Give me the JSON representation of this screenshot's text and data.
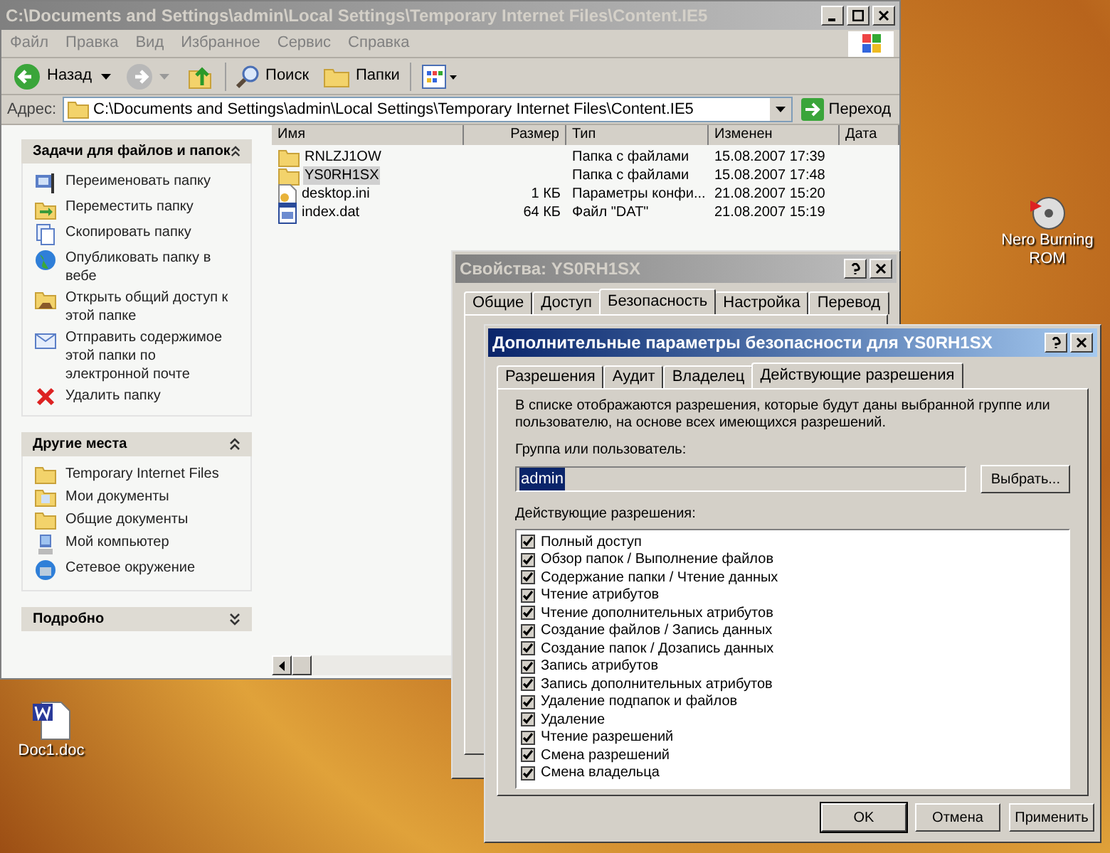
{
  "desktop_icons": [
    {
      "label": "Nero Burning ROM",
      "kind": "disc"
    },
    {
      "label": "Doc1.doc",
      "kind": "document"
    }
  ],
  "explorer": {
    "title": "C:\\Documents and Settings\\admin\\Local Settings\\Temporary Internet Files\\Content.IE5",
    "menu": [
      "Файл",
      "Правка",
      "Вид",
      "Избранное",
      "Сервис",
      "Справка"
    ],
    "toolbar": {
      "back": "Назад",
      "search": "Поиск",
      "folders": "Папки"
    },
    "address": {
      "label": "Адрес:",
      "value": "C:\\Documents and Settings\\admin\\Local Settings\\Temporary Internet Files\\Content.IE5",
      "go": "Переход"
    },
    "task_panes": [
      {
        "title": "Задачи для файлов и папок",
        "expanded": true,
        "items": [
          {
            "label": "Переименовать папку",
            "kind": "rename"
          },
          {
            "label": "Переместить папку",
            "kind": "move"
          },
          {
            "label": "Скопировать папку",
            "kind": "copy"
          },
          {
            "label": "Опубликовать папку в вебе",
            "kind": "web"
          },
          {
            "label": "Открыть общий доступ к этой папке",
            "kind": "share"
          },
          {
            "label": "Отправить содержимое этой папки по электронной почте",
            "kind": "mail"
          },
          {
            "label": "Удалить папку",
            "kind": "delete"
          }
        ]
      },
      {
        "title": "Другие места",
        "expanded": true,
        "items": [
          {
            "label": "Temporary Internet Files",
            "kind": "folder"
          },
          {
            "label": "Мои документы",
            "kind": "documents"
          },
          {
            "label": "Общие документы",
            "kind": "folder"
          },
          {
            "label": "Мой компьютер",
            "kind": "computer"
          },
          {
            "label": "Сетевое окружение",
            "kind": "network"
          }
        ]
      },
      {
        "title": "Подробно",
        "expanded": false
      }
    ],
    "file_list": {
      "columns": [
        "Имя",
        "Размер",
        "Тип",
        "Изменен",
        "Дата"
      ],
      "rows": [
        {
          "name": "RNLZJ1OW",
          "size": "",
          "type": "Папка с файлами",
          "modified": "15.08.2007 17:39",
          "kind": "folder",
          "selected": false
        },
        {
          "name": "YS0RH1SX",
          "size": "",
          "type": "Папка с файлами",
          "modified": "15.08.2007 17:48",
          "kind": "folder",
          "selected": true
        },
        {
          "name": "desktop.ini",
          "size": "1 КБ",
          "type": "Параметры конфи...",
          "modified": "21.08.2007 15:20",
          "kind": "settings",
          "selected": false
        },
        {
          "name": "index.dat",
          "size": "64 КБ",
          "type": "Файл \"DAT\"",
          "modified": "21.08.2007 15:19",
          "kind": "data",
          "selected": false
        }
      ]
    }
  },
  "properties_dialog": {
    "title": "Свойства: YS0RH1SX",
    "tabs": [
      {
        "label": "Общие",
        "selected": false
      },
      {
        "label": "Доступ",
        "selected": false
      },
      {
        "label": "Безопасность",
        "selected": true
      },
      {
        "label": "Настройка",
        "selected": false
      },
      {
        "label": "Перевод",
        "selected": false
      }
    ]
  },
  "advanced_dialog": {
    "title": "Дополнительные параметры безопасности для YS0RH1SX",
    "tabs": [
      {
        "label": "Разрешения",
        "selected": false
      },
      {
        "label": "Аудит",
        "selected": false
      },
      {
        "label": "Владелец",
        "selected": false
      },
      {
        "label": "Действующие разрешения",
        "selected": true
      }
    ],
    "description": "В списке отображаются разрешения, которые будут даны выбранной группе или пользователю, на основе всех имеющихся разрешений.",
    "group_label": "Группа или пользователь:",
    "user": "admin",
    "select_button": "Выбрать...",
    "permissions_label": "Действующие разрешения:",
    "permissions": [
      {
        "label": "Полный доступ",
        "checked": true
      },
      {
        "label": "Обзор папок / Выполнение файлов",
        "checked": true
      },
      {
        "label": "Содержание папки / Чтение данных",
        "checked": true
      },
      {
        "label": "Чтение атрибутов",
        "checked": true
      },
      {
        "label": "Чтение дополнительных атрибутов",
        "checked": true
      },
      {
        "label": "Создание файлов / Запись данных",
        "checked": true
      },
      {
        "label": "Создание папок / Дозапись данных",
        "checked": true
      },
      {
        "label": "Запись атрибутов",
        "checked": true
      },
      {
        "label": "Запись дополнительных атрибутов",
        "checked": true
      },
      {
        "label": "Удаление подпапок и файлов",
        "checked": true
      },
      {
        "label": "Удаление",
        "checked": true
      },
      {
        "label": "Чтение разрешений",
        "checked": true
      },
      {
        "label": "Смена разрешений",
        "checked": true
      },
      {
        "label": "Смена владельца",
        "checked": true
      }
    ],
    "buttons": [
      "OK",
      "Отмена",
      "Применить"
    ]
  }
}
